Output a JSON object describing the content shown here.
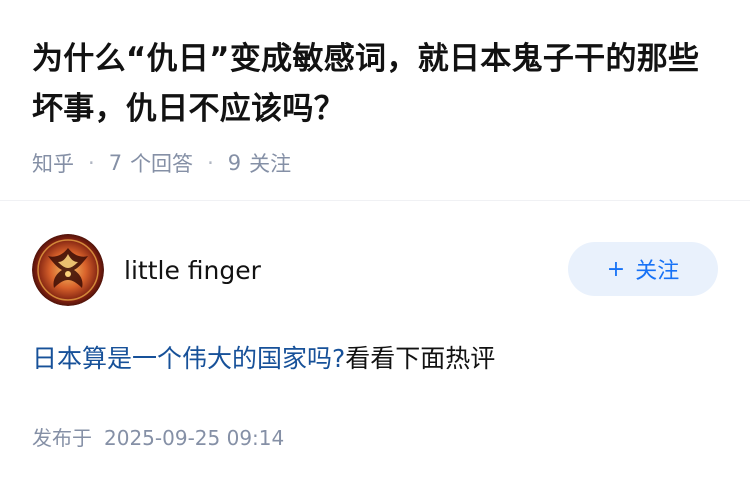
{
  "question": {
    "title": "为什么“仇日”变成敏感词，就日本鬼子干的那些坏事，仇日不应该吗？",
    "source": "知乎",
    "separator": "·",
    "answers_count": "7",
    "answers_label": "个回答",
    "followers_count": "9",
    "followers_label": "关注"
  },
  "answer": {
    "author_name": "little finger",
    "avatar_icon": "phoenix-avatar-icon",
    "follow_plus": "+",
    "follow_label": "关注",
    "content_link": "日本算是一个伟大的国家吗?",
    "content_text": "看看下面热评",
    "published_label": "发布于",
    "published_date": "2025-09-25 09:14"
  },
  "colors": {
    "text": "#121212",
    "meta": "#8590a6",
    "link": "#175199",
    "accent": "#1772f6",
    "follow_bg": "#e9f1fc"
  }
}
